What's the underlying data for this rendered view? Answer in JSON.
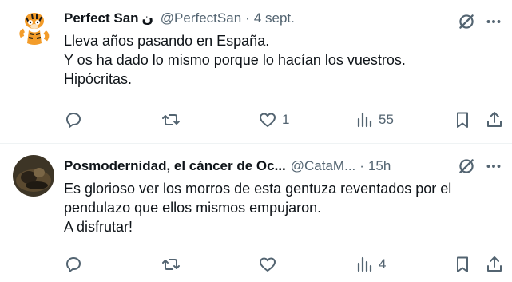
{
  "tweets": [
    {
      "display_name": "Perfect San",
      "name_suffix": "ن",
      "handle": "@PerfectSan",
      "separator": "·",
      "time": "4 sept.",
      "lines": [
        "Lleva años pasando en España.",
        "Y os ha dado lo mismo porque lo hacían los vuestros.",
        "Hipócritas."
      ],
      "reply_count": "",
      "retweet_count": "",
      "like_count": "1",
      "view_count": "55"
    },
    {
      "display_name": "Posmodernidad, el cáncer de Oc...",
      "handle": "@CataM...",
      "separator": "·",
      "time": "15h",
      "lines": [
        "Es glorioso ver los morros de esta gentuza reventados por el",
        "pendulazo que ellos mismos empujaron.",
        "A disfrutar!"
      ],
      "reply_count": "",
      "retweet_count": "",
      "like_count": "",
      "view_count": "4"
    }
  ],
  "icons": {
    "reply": "reply-icon",
    "retweet": "retweet-icon",
    "like": "like-icon",
    "views": "views-icon",
    "bookmark": "bookmark-icon",
    "share": "share-icon",
    "grok": "grok-icon",
    "more": "more-icon"
  },
  "colors": {
    "text": "#0f1419",
    "secondary": "#536471",
    "divider": "#eff3f4"
  }
}
